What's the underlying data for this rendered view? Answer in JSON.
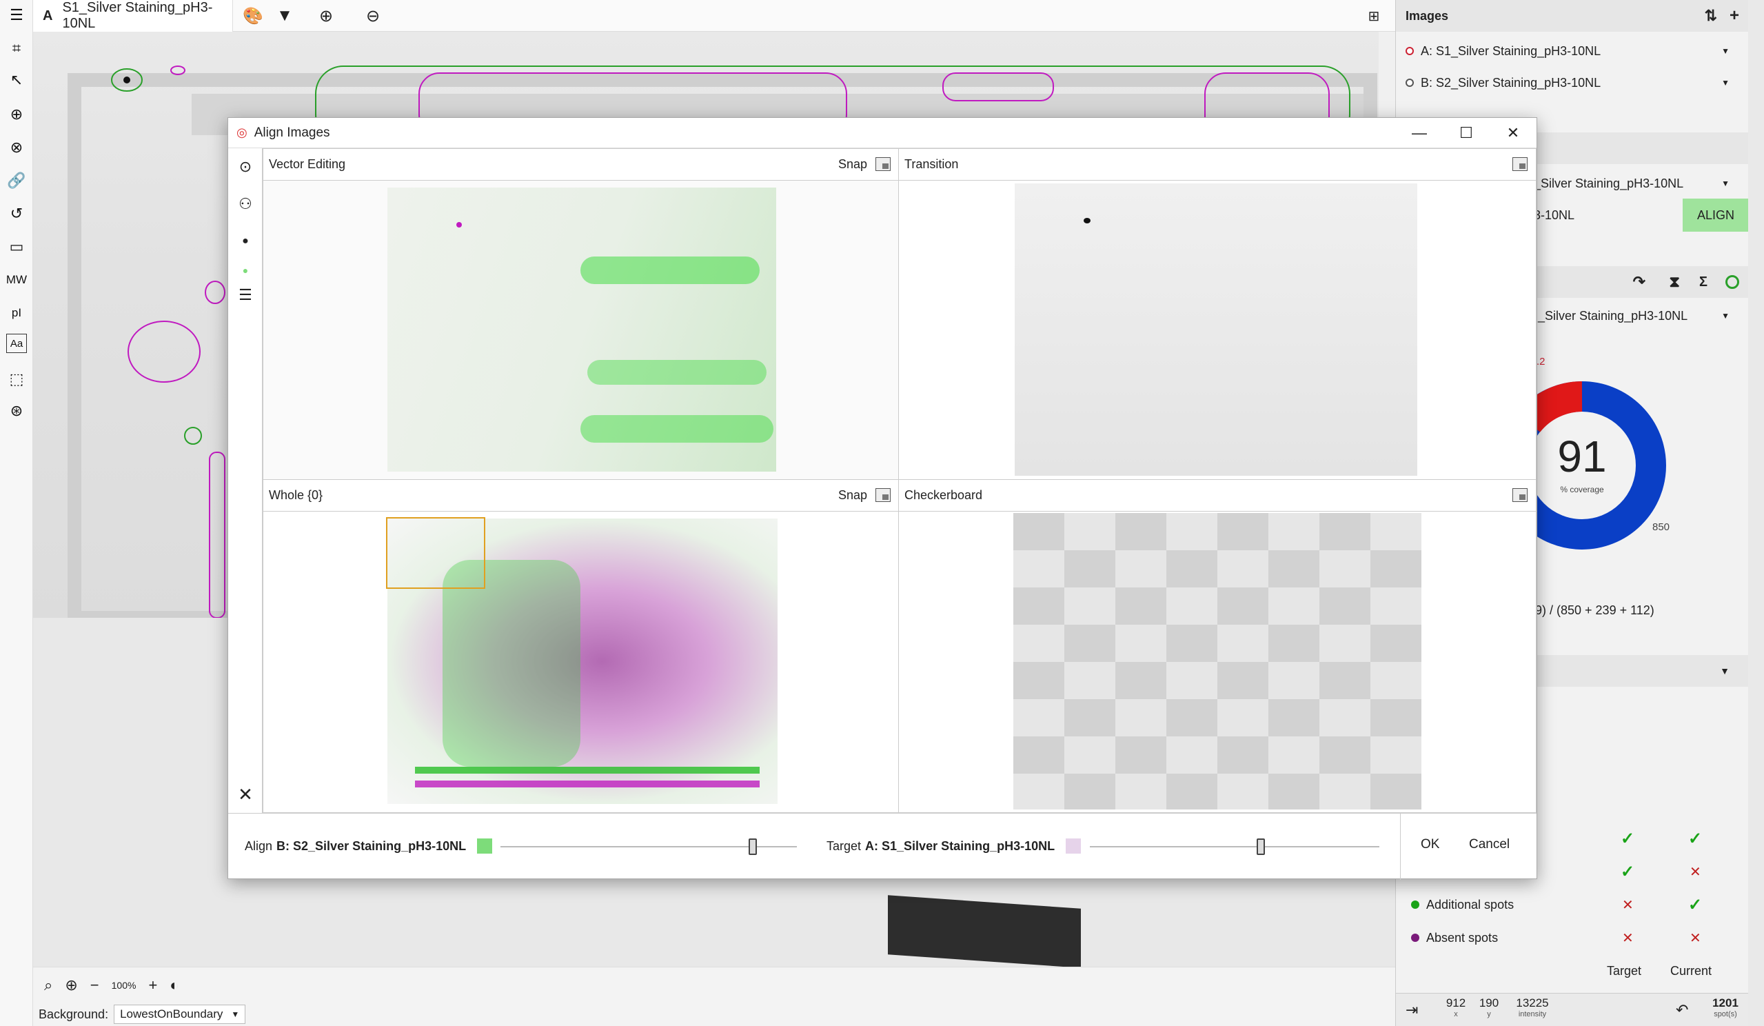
{
  "toolbar_left": {
    "icons": [
      "menu-icon",
      "crop-icon",
      "pointer-icon",
      "add-spot-icon",
      "lasso-icon",
      "link-icon",
      "undo-arrow-icon",
      "oval-icon",
      "mw-label",
      "pi-label",
      "text-icon",
      "select-rect-icon",
      "delete-spot-icon"
    ],
    "mw": "MW",
    "pi": "pI",
    "aa": "Aa"
  },
  "topbar": {
    "doc_letter": "A",
    "doc_title": "S1_Silver Staining_pH3-10NL"
  },
  "status": {
    "zoom": "100%"
  },
  "background": {
    "label": "Background:",
    "value": "LowestOnBoundary"
  },
  "right_panel": {
    "images_header": "Images",
    "image_a": "A: S1_Silver Staining_pH3-10NL",
    "image_b": "B: S2_Silver Staining_pH3-10NL",
    "align_row_top": "_Silver Staining_pH3-10NL",
    "align_row_bottom": "3-10NL",
    "align_button": "ALIGN",
    "stats_select": "_Silver Staining_pH3-10NL",
    "donut_center": "91",
    "donut_sub": "% coverage",
    "donut_small_top": ".2",
    "donut_small_right": "850",
    "formula": "9) / (850 + 239 + 112)",
    "legend": [
      {
        "label": "Additional spots",
        "color": "#1aa318",
        "target": "✕",
        "current": "✓"
      },
      {
        "label": "Absent spots",
        "color": "#7a1a7a",
        "target": "✕",
        "current": "✕"
      }
    ],
    "matrix_rows": [
      {
        "target": "✓",
        "current": "✓"
      },
      {
        "target": "✓",
        "current": "✕"
      }
    ],
    "col_target": "Target",
    "col_current": "Current",
    "readout": {
      "x_val": "912",
      "x_lbl": "x",
      "y_val": "190",
      "y_lbl": "y",
      "i_val": "13225",
      "i_lbl": "intensity",
      "spots_val": "1201",
      "spots_lbl": "spot(s)"
    }
  },
  "dialog": {
    "title": "Align Images",
    "panes": {
      "vector": {
        "title": "Vector Editing",
        "snap": "Snap"
      },
      "transition": {
        "title": "Transition"
      },
      "whole": {
        "title": "Whole {0}",
        "snap": "Snap"
      },
      "checker": {
        "title": "Checkerboard"
      }
    },
    "footer": {
      "align_prefix": "Align",
      "align_image": "B: S2_Silver Staining_pH3-10NL",
      "align_color": "#7ddc7a",
      "align_level": 0.85,
      "target_prefix": "Target",
      "target_image": "A: S1_Silver Staining_pH3-10NL",
      "target_color": "#e6d3ea",
      "target_level": 0.59,
      "ok": "OK",
      "cancel": "Cancel"
    }
  }
}
